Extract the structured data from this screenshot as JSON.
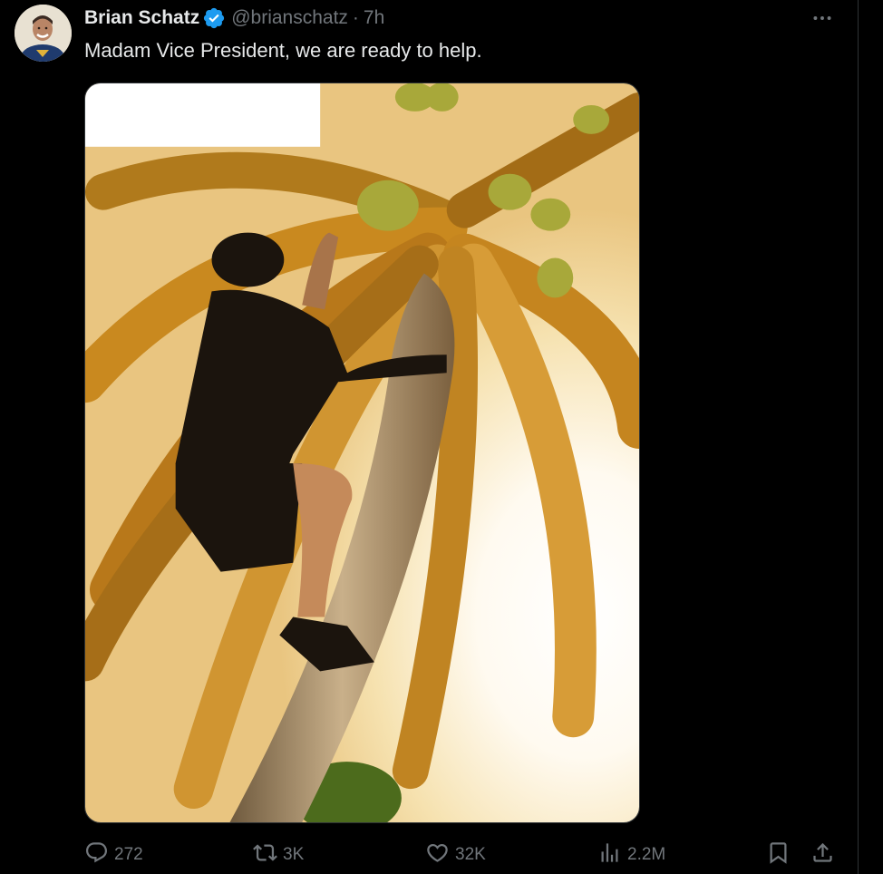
{
  "tweet": {
    "author_name": "Brian Schatz",
    "handle": "@brianschatz",
    "separator": "·",
    "time": "7h",
    "text": "Madam Vice President, we are ready to help.",
    "verified_color": "#1d9bf0"
  },
  "icons": {
    "avatar": "profile-photo",
    "verified": "verified-badge-icon",
    "more": "more-dots-icon",
    "reply": "reply-icon",
    "repost": "repost-icon",
    "like": "heart-icon",
    "views": "views-bar-chart-icon",
    "bookmark": "bookmark-icon",
    "share": "share-icon"
  },
  "actions": {
    "reply_count": "272",
    "repost_count": "3K",
    "like_count": "32K",
    "views_count": "2.2M"
  },
  "colors": {
    "background": "#000000",
    "text_primary": "#e7e9ea",
    "text_secondary": "#71767b",
    "border": "#2f3336"
  }
}
